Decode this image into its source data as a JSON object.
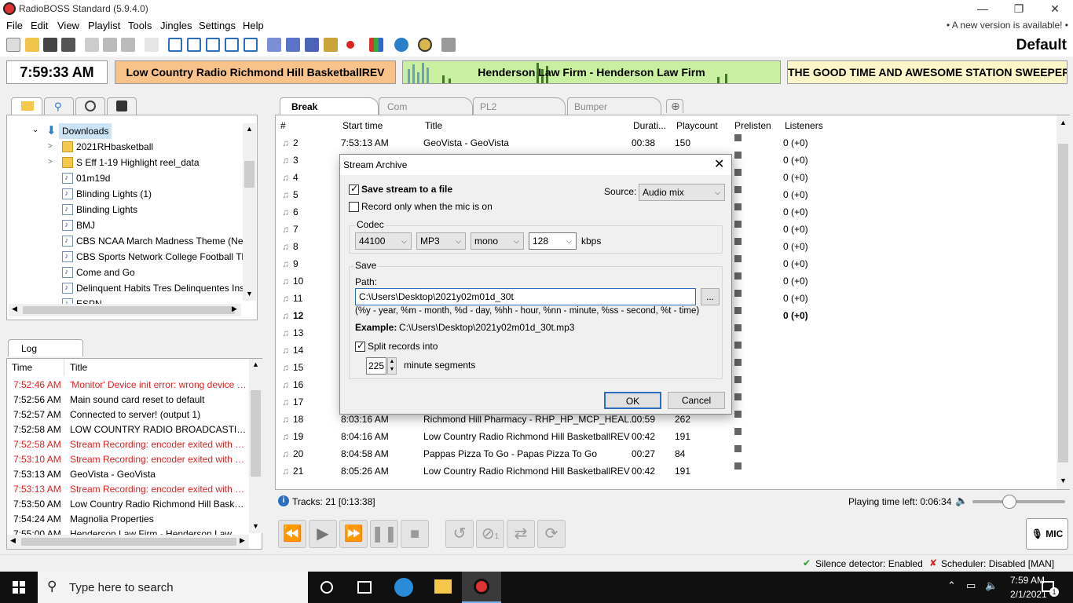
{
  "window": {
    "title": "RadioBOSS Standard (5.9.4.0)"
  },
  "menu": {
    "items": [
      "File",
      "Edit",
      "View",
      "Playlist",
      "Tools",
      "Jingles",
      "Settings",
      "Help"
    ],
    "new_version": "• A new version is available! •"
  },
  "toolbar": {
    "profile": "Default"
  },
  "info": {
    "clock": "7:59:33 AM",
    "now": "Low Country Radio Richmond Hill BasketballREV",
    "next": "Henderson Law Firm - Henderson Law Firm",
    "sweeper": "THE GOOD TIME AND AWESOME STATION SWEEPER"
  },
  "browser": {
    "root": "Downloads",
    "items": [
      {
        "label": "2021RHbasketball",
        "type": "folder"
      },
      {
        "label": "S Eff 1-19 Highlight reel_data",
        "type": "folder"
      },
      {
        "label": "01m19d",
        "type": "file"
      },
      {
        "label": "Blinding Lights (1)",
        "type": "file"
      },
      {
        "label": "Blinding Lights",
        "type": "file"
      },
      {
        "label": "BMJ",
        "type": "file"
      },
      {
        "label": "CBS NCAA March Madness Theme (New",
        "type": "file"
      },
      {
        "label": "CBS Sports Network College Football Th",
        "type": "file"
      },
      {
        "label": "Come and Go",
        "type": "file"
      },
      {
        "label": "Delinquent Habits Tres Delinquentes Inst",
        "type": "file"
      },
      {
        "label": "ESPN",
        "type": "file"
      }
    ]
  },
  "log": {
    "tab": "Log",
    "col_time": "Time",
    "col_title": "Title",
    "rows": [
      {
        "time": "7:52:46 AM",
        "title": "'Monitor' Device init error: wrong device s...",
        "error": true
      },
      {
        "time": "7:52:56 AM",
        "title": "Main sound card reset to default",
        "error": false
      },
      {
        "time": "7:52:57 AM",
        "title": "Connected to server! (output 1)",
        "error": false
      },
      {
        "time": "7:52:58 AM",
        "title": "LOW COUNTRY RADIO BROADCASTING ...",
        "error": false
      },
      {
        "time": "7:52:58 AM",
        "title": "Stream Recording: encoder exited with an...",
        "error": true
      },
      {
        "time": "7:53:10 AM",
        "title": "Stream Recording: encoder exited with an...",
        "error": true
      },
      {
        "time": "7:53:13 AM",
        "title": "GeoVista - GeoVista",
        "error": false
      },
      {
        "time": "7:53:13 AM",
        "title": "Stream Recording: encoder exited with an...",
        "error": true
      },
      {
        "time": "7:53:50 AM",
        "title": "Low Country Radio Richmond Hill Basket...",
        "error": false
      },
      {
        "time": "7:54:24 AM",
        "title": "Magnolia Properties",
        "error": false
      },
      {
        "time": "7:55:00 AM",
        "title": "Henderson Law Firm - Henderson Law Firm",
        "error": false
      }
    ]
  },
  "playlist": {
    "tabs": [
      "Break",
      "Com",
      "PL2",
      "Bumper"
    ],
    "columns": {
      "num": "#",
      "start": "Start time",
      "title": "Title",
      "duration": "Durati...",
      "playcount": "Playcount",
      "prelisten": "Prelisten",
      "listeners": "Listeners"
    },
    "rows": [
      {
        "num": "2",
        "start": "7:53:13 AM",
        "title": "GeoVista - GeoVista",
        "dur": "00:38",
        "count": "150",
        "listeners": "0 (+0)"
      },
      {
        "num": "3",
        "start": "",
        "title": "",
        "dur": "",
        "count": "",
        "listeners": "0 (+0)"
      },
      {
        "num": "4",
        "start": "",
        "title": "",
        "dur": "",
        "count": "",
        "listeners": "0 (+0)"
      },
      {
        "num": "5",
        "start": "",
        "title": "",
        "dur": "",
        "count": "",
        "listeners": "0 (+0)"
      },
      {
        "num": "6",
        "start": "",
        "title": "",
        "dur": "",
        "count": "",
        "listeners": "0 (+0)"
      },
      {
        "num": "7",
        "start": "",
        "title": "",
        "dur": "",
        "count": "",
        "listeners": "0 (+0)"
      },
      {
        "num": "8",
        "start": "",
        "title": "",
        "dur": "",
        "count": "",
        "listeners": "0 (+0)"
      },
      {
        "num": "9",
        "start": "",
        "title": "",
        "dur": "",
        "count": "",
        "listeners": "0 (+0)"
      },
      {
        "num": "10",
        "start": "",
        "title": "",
        "dur": "",
        "count": "",
        "listeners": "0 (+0)"
      },
      {
        "num": "11",
        "start": "",
        "title": "",
        "dur": "",
        "count": "",
        "listeners": "0 (+0)"
      },
      {
        "num": "12",
        "start": "",
        "title": "",
        "dur": "",
        "count": "",
        "listeners": "0 (+0)",
        "bold": true
      },
      {
        "num": "13",
        "start": "",
        "title": "",
        "dur": "",
        "count": "",
        "listeners": ""
      },
      {
        "num": "14",
        "start": "",
        "title": "",
        "dur": "",
        "count": "",
        "listeners": ""
      },
      {
        "num": "15",
        "start": "",
        "title": "",
        "dur": "",
        "count": "",
        "listeners": ""
      },
      {
        "num": "16",
        "start": "",
        "title": "",
        "dur": "",
        "count": "",
        "listeners": ""
      },
      {
        "num": "17",
        "start": "",
        "title": "",
        "dur": "",
        "count": "",
        "listeners": ""
      },
      {
        "num": "18",
        "start": "8:03:16 AM",
        "title": "Richmond Hill Pharmacy - RHP_HP_MCP_HEAL...",
        "dur": "00:59",
        "count": "262",
        "listeners": ""
      },
      {
        "num": "19",
        "start": "8:04:16 AM",
        "title": "Low Country Radio Richmond Hill BasketballREV",
        "dur": "00:42",
        "count": "191",
        "listeners": ""
      },
      {
        "num": "20",
        "start": "8:04:58 AM",
        "title": "Pappas Pizza To Go - Papas Pizza To Go",
        "dur": "00:27",
        "count": "84",
        "listeners": ""
      },
      {
        "num": "21",
        "start": "8:05:26 AM",
        "title": "Low Country Radio Richmond Hill BasketballREV",
        "dur": "00:42",
        "count": "191",
        "listeners": ""
      }
    ],
    "tracks": "Tracks: 21 [0:13:38]",
    "time_left": "Playing time left: 0:06:34"
  },
  "transport": {
    "repeat_count": "1",
    "mic": "MIC"
  },
  "statusbar": {
    "silence": "Silence detector: Enabled",
    "scheduler": "Scheduler: Disabled [MAN]"
  },
  "dialog": {
    "title": "Stream Archive",
    "save_stream": "Save stream to a file",
    "record_mic": "Record only when the mic is on",
    "source_label": "Source:",
    "source_value": "Audio mix",
    "codec_label": "Codec",
    "samplerate": "44100",
    "format": "MP3",
    "channels": "mono",
    "bitrate": "128",
    "kbps": "kbps",
    "save_label": "Save",
    "path_label": "Path:",
    "path_value": "C:\\Users\\Desktop\\2021y02m01d_30t",
    "browse": "...",
    "hint": "(%y - year, %m - month, %d - day, %hh - hour, %nn - minute, %ss - second, %t - time)",
    "example_label": "Example:",
    "example_value": "C:\\Users\\Desktop\\2021y02m01d_30t.mp3",
    "split_label": "Split records into",
    "split_value": "225",
    "split_unit": "minute segments",
    "ok": "OK",
    "cancel": "Cancel"
  },
  "taskbar": {
    "search": "Type here to search",
    "time": "7:59 AM",
    "date": "2/1/2021",
    "notifications": "1"
  }
}
